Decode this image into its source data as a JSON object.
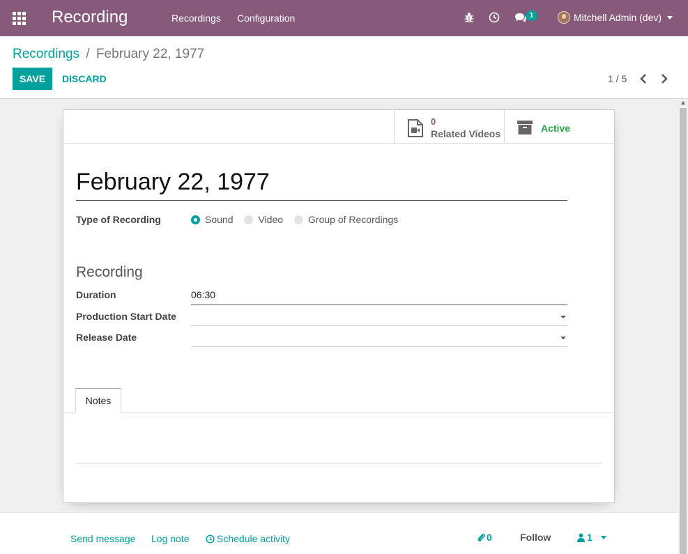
{
  "navbar": {
    "app_title": "Recording",
    "menu": [
      "Recordings",
      "Configuration"
    ],
    "messages_badge": "1",
    "user_name": "Mitchell Admin (dev)",
    "bg_color": "#875A7B"
  },
  "breadcrumb": {
    "parent": "Recordings",
    "separator": "/",
    "current": "February 22, 1977"
  },
  "actions": {
    "save_label": "SAVE",
    "discard_label": "DISCARD"
  },
  "pager": {
    "value": "1 / 5"
  },
  "button_box": {
    "related_videos_count": "0",
    "related_videos_label": "Related Videos",
    "active_label": "Active"
  },
  "form": {
    "title": "February 22, 1977",
    "type_label": "Type of Recording",
    "type_options": [
      "Sound",
      "Video",
      "Group of Recordings"
    ],
    "type_selected": "Sound",
    "section_title": "Recording",
    "duration_label": "Duration",
    "duration_value": "06:30",
    "production_start_label": "Production Start Date",
    "production_start_value": "",
    "release_date_label": "Release Date",
    "release_date_value": "",
    "tab_notes": "Notes"
  },
  "chatter": {
    "send_message": "Send message",
    "log_note": "Log note",
    "schedule_activity": "Schedule activity",
    "attachments_count": "0",
    "follow": "Follow",
    "followers_count": "1"
  },
  "colors": {
    "accent": "#00A09D",
    "brand": "#875A7B",
    "active_green": "#28a745"
  }
}
